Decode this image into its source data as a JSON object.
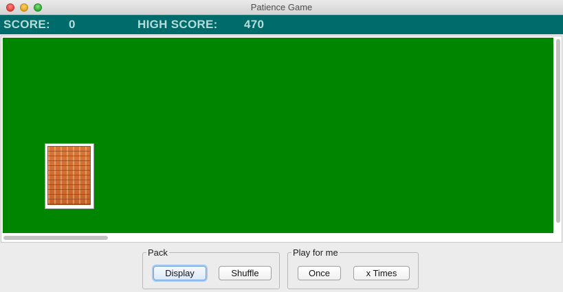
{
  "window": {
    "title": "Patience Game"
  },
  "scorebar": {
    "score_label": "SCORE:",
    "score_value": "0",
    "high_score_label": "HIGH SCORE:",
    "high_score_value": "470",
    "background_color": "#006b6b"
  },
  "table": {
    "felt_color": "#008500",
    "cards": [
      {
        "face": "back"
      }
    ]
  },
  "pack_group": {
    "label": "Pack",
    "display_button": "Display",
    "shuffle_button": "Shuffle"
  },
  "play_group": {
    "label": "Play for me",
    "once_button": "Once",
    "x_times_button": "x Times"
  }
}
